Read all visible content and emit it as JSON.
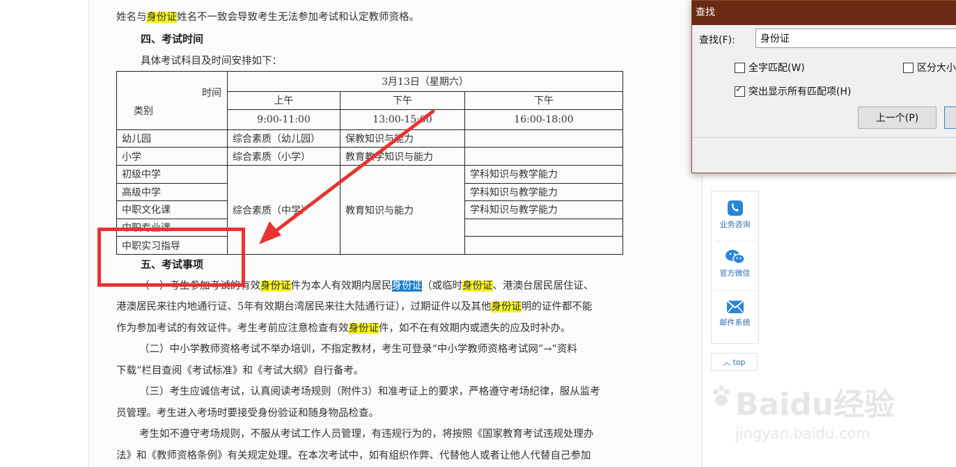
{
  "find_dialog": {
    "title": "查找",
    "find_label": "查找(F):",
    "query": "身份证",
    "whole_word_label": "全字匹配(W)",
    "whole_word_checked": false,
    "match_case_label": "区分大小",
    "match_case_checked": false,
    "highlight_all_label": "突出显示所有匹配项(H)",
    "highlight_all_checked": true,
    "prev_button": "上一个(P)"
  },
  "document": {
    "top_line_a": "姓名与",
    "top_line_hl": "身份证",
    "top_line_b": "姓名不一致会导致考生无法参加考试和认定教师资格。",
    "section4_title": "四、考试时间",
    "intro": "具体考试科目及时间安排如下：",
    "table": {
      "date_header": "3月13日（星期六）",
      "corner_time": "时间",
      "corner_type": "类别",
      "periods": [
        "上午",
        "下午",
        "下午"
      ],
      "times": [
        "9:00-11:00",
        "13:00-15:00",
        "16:00-18:00"
      ],
      "categories": [
        "幼儿园",
        "小学",
        "初级中学",
        "高级中学",
        "中职文化课",
        "中职专业课",
        "中职实习指导"
      ],
      "kindergarten": [
        "综合素质（幼儿园）",
        "保教知识与能力",
        ""
      ],
      "primary": [
        "综合素质（小学）",
        "教育教学知识与能力",
        ""
      ],
      "middle_subject1": "综合素质（中学）",
      "middle_subject2": "教育知识与能力",
      "middle_subject3": [
        "学科知识与教学能力",
        "学科知识与教学能力",
        "学科知识与教学能力",
        "",
        ""
      ]
    },
    "section5_title": "五、考试事项",
    "p1_l1": [
      "（一）考生参加考试的有效",
      "身份证",
      "件为本人有效期内居民",
      "身份证",
      "（或临时",
      "身份证",
      "、港澳台居民居住证、"
    ],
    "p1_l2": [
      "港澳居民来往内地通行证、5年有效期台湾居民来往大陆通行证），过期证件以及其他",
      "身份证",
      "明的证件都不能"
    ],
    "p1_l3": [
      "作为参加考试的有效证件。考生考前应注意检查有效",
      "身份证",
      "件，如不在有效期内或遗失的应及时补办。"
    ],
    "p2_l1": "（二）中小学教师资格考试不举办培训，不指定教材，考生可登录“中小学教师资格考试网”→“资料",
    "p2_l2": "下载”栏目查阅《考试标准》和《考试大纲》自行备考。",
    "p3_l1": "（三）考生应诚信考试，认真阅读考场规则（附件3）和准考证上的要求，严格遵守考场纪律，服从监考",
    "p3_l2": "员管理。考生进入考场时要接受身份验证和随身物品检查。",
    "p4_l1": "考生如不遵守考场规则，不服从考试工作人员管理，有违规行为的，将按照《国家教育考试违规处理办",
    "p4_l2": "法》和《教师资格条例》有关规定处理。在本次考试中，如有组织作弊、代替他人或者让他人代替自己参加"
  },
  "sidebar": {
    "items": [
      "业务咨询",
      "官方微信",
      "邮件系统"
    ],
    "top_label": "top"
  },
  "watermark": {
    "logo": "Baidu经验",
    "url": "jingyan.baidu.com"
  },
  "colors": {
    "highlight": "#f5f31b",
    "current_match": "#1e7fd0",
    "annotation": "#e8332f",
    "dialog_title": "#6b2a14"
  }
}
